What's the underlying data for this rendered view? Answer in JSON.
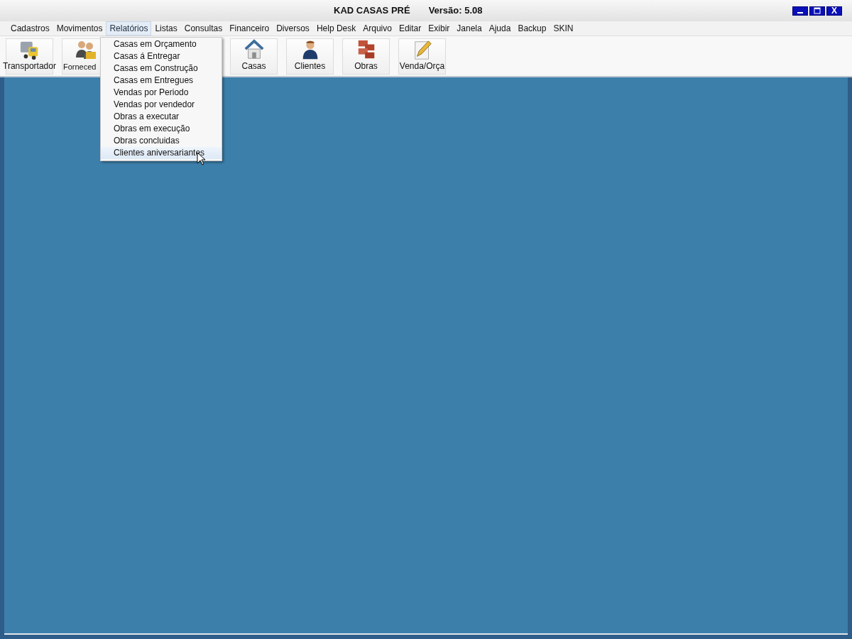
{
  "window": {
    "title": "KAD CASAS PRÉ",
    "version": "Versão: 5.08"
  },
  "title_buttons": [
    {
      "kind": "minimize"
    },
    {
      "kind": "maximize"
    },
    {
      "kind": "close",
      "label": "X"
    }
  ],
  "menu_bar": [
    {
      "label": "Cadastros",
      "selected": false
    },
    {
      "label": "Movimentos",
      "selected": false
    },
    {
      "label": "Relatórios",
      "selected": true
    },
    {
      "label": "Listas",
      "selected": false
    },
    {
      "label": "Consultas",
      "selected": false
    },
    {
      "label": "Financeiro",
      "selected": false
    },
    {
      "label": "Diversos",
      "selected": false
    },
    {
      "label": "Help Desk",
      "selected": false
    },
    {
      "label": "Arquivo",
      "selected": false
    },
    {
      "label": "Editar",
      "selected": false
    },
    {
      "label": "Exibir",
      "selected": false
    },
    {
      "label": "Janela",
      "selected": false
    },
    {
      "label": "Ajuda",
      "selected": false
    },
    {
      "label": "Backup",
      "selected": false
    },
    {
      "label": "SKIN",
      "selected": false
    }
  ],
  "toolbar": [
    {
      "label": "Transportador",
      "kind": "truck"
    },
    {
      "label": "Forneced",
      "kind": "people"
    },
    {
      "kind": "hidden"
    },
    {
      "kind": "hidden"
    },
    {
      "label": "Casas",
      "kind": "house"
    },
    {
      "label": "Clientes",
      "kind": "person"
    },
    {
      "label": "Obras",
      "kind": "bricks"
    },
    {
      "label": "Venda/Orça",
      "kind": "pencil"
    }
  ],
  "dropdown_menu": [
    {
      "label": "Casas em Orçamento",
      "selected": false
    },
    {
      "label": "Casas á Entregar",
      "selected": false
    },
    {
      "label": "Casas em Construção",
      "selected": false
    },
    {
      "label": "Casas em Entregues",
      "selected": false
    },
    {
      "label": "Vendas por Periodo",
      "selected": false
    },
    {
      "label": "Vendas por vendedor",
      "selected": false
    },
    {
      "label": "Obras a executar",
      "selected": false
    },
    {
      "label": "Obras em execução",
      "selected": false
    },
    {
      "label": "Obras concluidas",
      "selected": false
    },
    {
      "label": "Clientes aniversariantes",
      "selected": true
    }
  ]
}
